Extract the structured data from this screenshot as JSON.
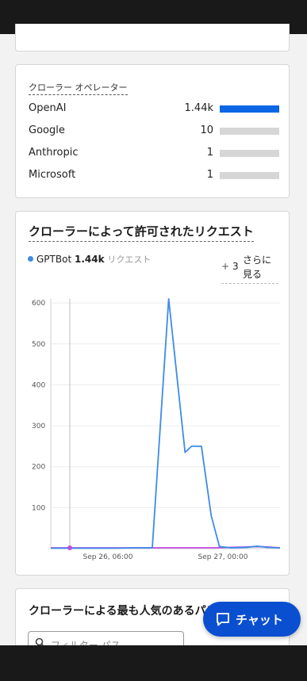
{
  "operators": {
    "title": "クローラー オペレーター",
    "rows": [
      {
        "name": "OpenAI",
        "value": "1.44k",
        "fraction": 1.0
      },
      {
        "name": "Google",
        "value": "10",
        "fraction": 0.0
      },
      {
        "name": "Anthropic",
        "value": "1",
        "fraction": 0.0
      },
      {
        "name": "Microsoft",
        "value": "1",
        "fraction": 0.0
      }
    ]
  },
  "allowed": {
    "title": "クローラーによって許可されたリクエスト",
    "legend": {
      "name": "GPTBot",
      "value": "1.44k",
      "unit": "リクエスト"
    },
    "more": {
      "plus": "+",
      "count": "3",
      "label": "さらに見る"
    }
  },
  "chart_data": {
    "type": "line",
    "x_ticks": [
      "Sep 26, 06:00",
      "Sep 27, 00:00"
    ],
    "y_ticks": [
      100,
      200,
      300,
      400,
      500,
      600
    ],
    "ylim": [
      0,
      610
    ],
    "series": [
      {
        "name": "GPTBot",
        "color": "#3d8be8",
        "x": [
          0,
          2,
          4,
          5.3,
          6.2,
          7.2,
          8.2,
          8.6,
          9.2,
          9.8,
          10.3,
          11,
          12,
          12.6,
          13.2,
          14
        ],
        "values": [
          1,
          1,
          1,
          2,
          2,
          610,
          235,
          250,
          250,
          80,
          5,
          2,
          3,
          6,
          3,
          2
        ]
      },
      {
        "color": "#c44be0",
        "x": [
          0,
          2,
          4,
          6,
          8,
          10,
          11,
          12,
          12.6,
          13.2,
          14
        ],
        "values": [
          2,
          2,
          2,
          2,
          2,
          2,
          3,
          4,
          5,
          4,
          2
        ]
      }
    ]
  },
  "popular": {
    "title": "クローラーによる最も人気のあるパス",
    "filter_placeholder": "フィルター パス"
  },
  "chat": {
    "label": "チャット"
  }
}
